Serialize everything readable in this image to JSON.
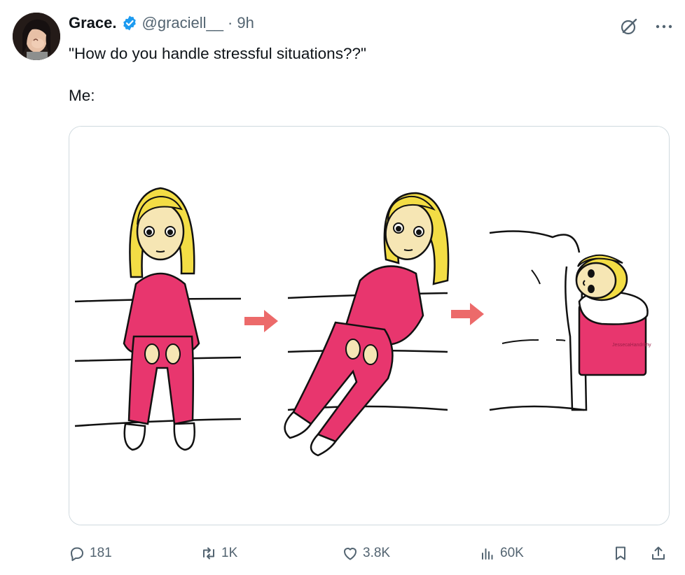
{
  "author": {
    "name": "Grace.",
    "handle": "@graciell__",
    "separator": "·",
    "time": "9h"
  },
  "tweet": {
    "text": "\"How do you handle stressful situations??\"\n\nMe:"
  },
  "media": {
    "watermark": "JessecaHandrithy",
    "colors": {
      "outfit": "#e8366e",
      "hair": "#f3dd45",
      "skin": "#f6e6b4",
      "arrow": "#ec6a6a"
    }
  },
  "stats": {
    "replies": "181",
    "retweets": "1K",
    "likes": "3.8K",
    "views": "60K"
  },
  "icons": {
    "verified": "verified-badge-icon",
    "grok": "grok-icon",
    "more": "more-icon",
    "reply": "reply-icon",
    "retweet": "retweet-icon",
    "like": "heart-icon",
    "views": "views-icon",
    "bookmark": "bookmark-icon",
    "share": "share-icon"
  },
  "theme": {
    "accent": "#1d9bf0",
    "muted": "#536471",
    "text": "#0f1419"
  }
}
